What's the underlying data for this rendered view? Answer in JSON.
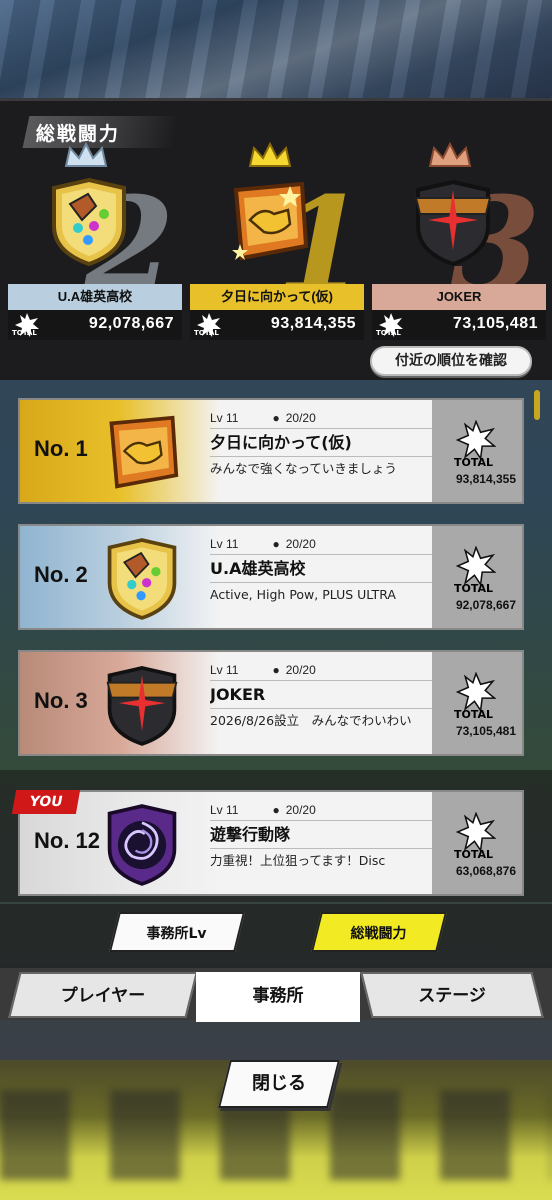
{
  "podium": {
    "title": "総戦闘力",
    "total_label": "TOTAL",
    "ranks": [
      {
        "rank_numeral": "2",
        "name": "U.A雄英高校",
        "total": "92,078,667"
      },
      {
        "rank_numeral": "1",
        "name": "夕日に向かって(仮)",
        "total": "93,814,355"
      },
      {
        "rank_numeral": "3",
        "name": "JOKER",
        "total": "73,105,481"
      }
    ],
    "nearby_button": "付近の順位を確認"
  },
  "list": {
    "rows": [
      {
        "rank": "No. 1",
        "lv": "Lv 11",
        "members": "20/20",
        "name": "夕日に向かって(仮)",
        "desc": "みんなで強くなっていきましょう",
        "total": "93,814,355",
        "total_label": "TOTAL"
      },
      {
        "rank": "No. 2",
        "lv": "Lv 11",
        "members": "20/20",
        "name": "U.A雄英高校",
        "desc": "Active, High Pow, PLUS ULTRA",
        "total": "92,078,667",
        "total_label": "TOTAL"
      },
      {
        "rank": "No. 3",
        "lv": "Lv 11",
        "members": "20/20",
        "name": "JOKER",
        "desc": "2026/8/26設立　みんなでわいわい",
        "total": "73,105,481",
        "total_label": "TOTAL"
      }
    ],
    "you": {
      "badge": "YOU",
      "rank": "No. 12",
      "lv": "Lv 11",
      "members": "20/20",
      "name": "遊撃行動隊",
      "desc": "力重視！上位狙ってます！Disc",
      "total": "63,068,876",
      "total_label": "TOTAL"
    }
  },
  "segment": {
    "office_lv": "事務所Lv",
    "total_power": "総戦闘力"
  },
  "tabs": {
    "player": "プレイヤー",
    "office": "事務所",
    "stage": "ステージ"
  },
  "close_button": "閉じる",
  "colors": {
    "gold": "#e8c02a",
    "silver": "#b9cfdf",
    "bronze": "#d8a898",
    "accent_yellow": "#f2ea23",
    "you_red": "#d01818"
  }
}
